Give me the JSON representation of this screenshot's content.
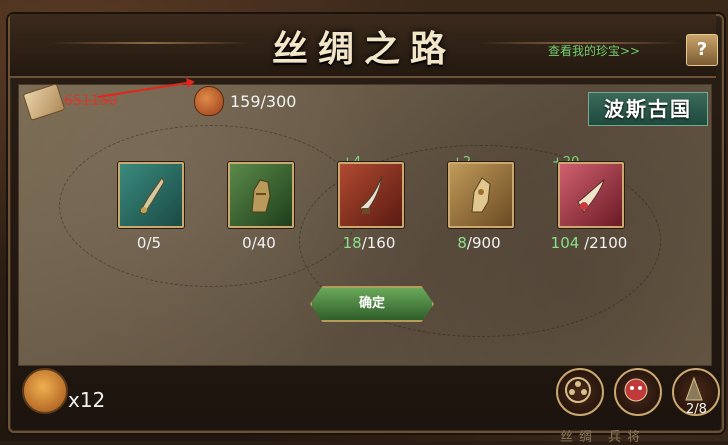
{
  "header": {
    "title": "丝绸之路",
    "treasure_link": "查看我的珍宝>>",
    "help_label": "?"
  },
  "resources": {
    "scroll_value": "651150",
    "bag_count": "159/300"
  },
  "region": {
    "name": "波斯古国"
  },
  "slots": [
    {
      "bonus": "",
      "have": "0",
      "need": "/5",
      "icon": "dagger-teal-icon",
      "bg": "#2a6a62"
    },
    {
      "bonus": "",
      "have": "0",
      "need": "/40",
      "icon": "gauntlet-green-icon",
      "bg": "#3e6a3a"
    },
    {
      "bonus": "+4",
      "have": "18",
      "need": "/160",
      "icon": "dagger-red-icon",
      "bg": "#8a2a1e"
    },
    {
      "bonus": "+2",
      "have": "8",
      "need": "/900",
      "icon": "gauntlet-gold-icon",
      "bg": "#8a6a36"
    },
    {
      "bonus": "+20",
      "have": "104",
      "need": " /2100",
      "icon": "dagger-pink-icon",
      "bg": "#9a3a44"
    }
  ],
  "confirm_label": "确定",
  "footer": {
    "item_count": "x12",
    "page": "2/8",
    "strip": "丝绸  兵将"
  },
  "colors": {
    "accent_green": "#7ad87a",
    "link_green": "#6fcf6f",
    "warning_red": "#d9362a"
  }
}
